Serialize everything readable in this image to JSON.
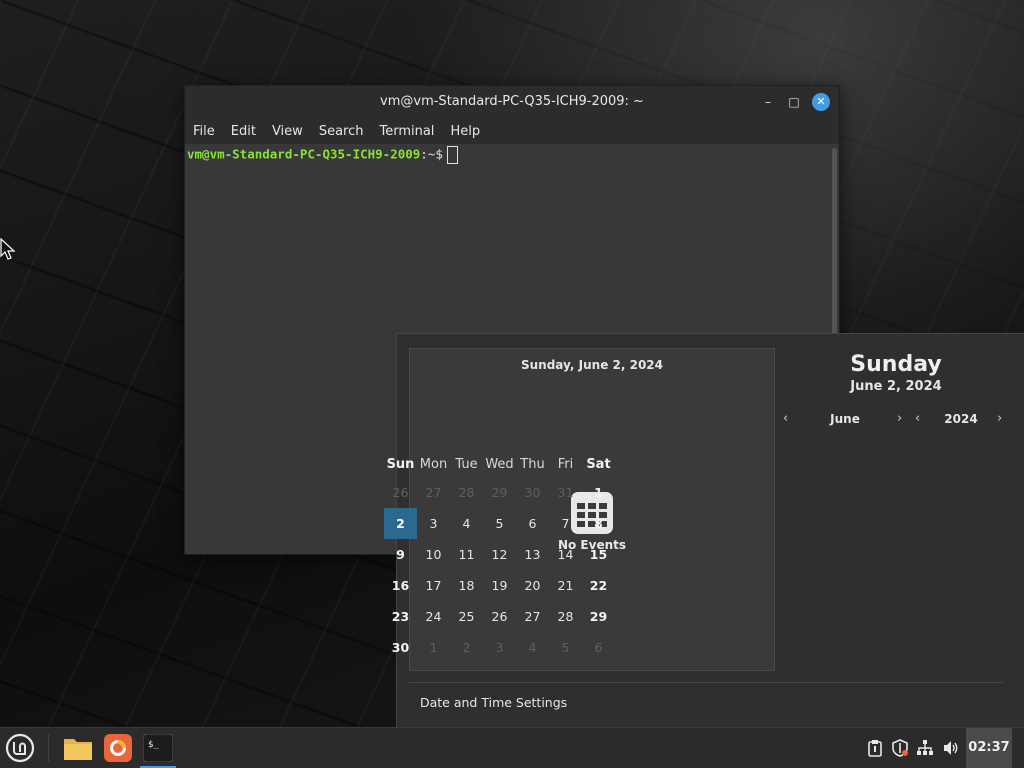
{
  "terminal": {
    "title": "vm@vm-Standard-PC-Q35-ICH9-2009: ~",
    "menu": [
      "File",
      "Edit",
      "View",
      "Search",
      "Terminal",
      "Help"
    ],
    "prompt_user": "vm@vm-Standard-PC-Q35-ICH9-2009",
    "prompt_path": ":~",
    "prompt_sign": "$"
  },
  "calendar": {
    "events_date": "Sunday, June 2, 2024",
    "no_events": "No Events",
    "day_name": "Sunday",
    "full_date": "June 2, 2024",
    "month": "June",
    "year": "2024",
    "weekdays": [
      "Sun",
      "Mon",
      "Tue",
      "Wed",
      "Thu",
      "Fri",
      "Sat"
    ],
    "weeks": [
      [
        "26",
        "27",
        "28",
        "29",
        "30",
        "31",
        "1"
      ],
      [
        "2",
        "3",
        "4",
        "5",
        "6",
        "7",
        "8"
      ],
      [
        "9",
        "10",
        "11",
        "12",
        "13",
        "14",
        "15"
      ],
      [
        "16",
        "17",
        "18",
        "19",
        "20",
        "21",
        "22"
      ],
      [
        "23",
        "24",
        "25",
        "26",
        "27",
        "28",
        "29"
      ],
      [
        "30",
        "1",
        "2",
        "3",
        "4",
        "5",
        "6"
      ]
    ],
    "today": "2",
    "settings_label": "Date and Time Settings"
  },
  "panel": {
    "clock": "02:37",
    "apps": [
      "menu-icon",
      "files-icon",
      "firefox-icon",
      "terminal-icon"
    ],
    "tray": [
      "clipboard-icon",
      "shield-update-icon",
      "network-icon",
      "volume-icon"
    ]
  },
  "colors": {
    "accent": "#3f9de0",
    "today_bg": "#2b6a8e",
    "prompt_green": "#8ae234"
  }
}
